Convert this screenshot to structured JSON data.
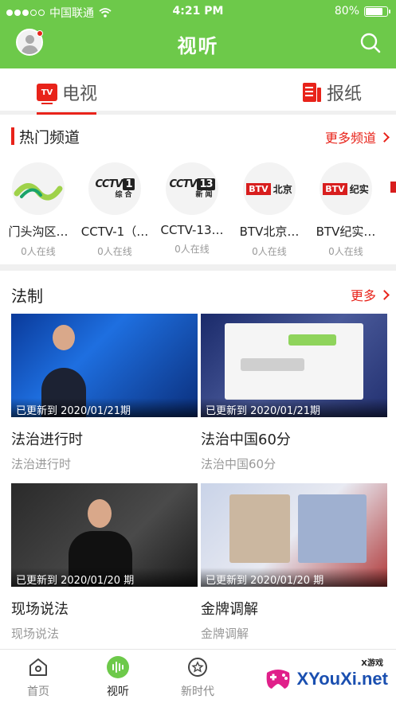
{
  "status_bar": {
    "carrier": "中国联通",
    "time": "4:21 PM",
    "battery": "80%",
    "battery_level": 0.8
  },
  "header": {
    "title": "视听"
  },
  "tabs": [
    {
      "label": "电视",
      "icon": "tv-icon",
      "icon_text": "TV",
      "active": true
    },
    {
      "label": "报纸",
      "icon": "newspaper-icon",
      "active": false
    }
  ],
  "hot_channels": {
    "title": "热门频道",
    "more": "更多频道",
    "items": [
      {
        "name": "门头沟区…",
        "online": "0人在线"
      },
      {
        "name": "CCTV-1（…",
        "online": "0人在线",
        "logo_text": "CCTV",
        "logo_num": "1",
        "logo_sub": "综合"
      },
      {
        "name": "CCTV-13…",
        "online": "0人在线",
        "logo_text": "CCTV",
        "logo_num": "13",
        "logo_sub": "新闻"
      },
      {
        "name": "BTV北京…",
        "online": "0人在线",
        "logo_text": "BTV",
        "logo_sub": "北京"
      },
      {
        "name": "BTV纪实…",
        "online": "0人在线",
        "logo_text": "BTV",
        "logo_sub": "纪实"
      }
    ]
  },
  "law_section": {
    "title": "法制",
    "more": "更多",
    "videos": [
      {
        "updated": "已更新到 2020/01/21期",
        "title": "法治进行时",
        "subtitle": "法治进行时"
      },
      {
        "updated": "已更新到 2020/01/21期",
        "title": "法治中国60分",
        "subtitle": "法治中国60分"
      },
      {
        "updated": "已更新到 2020/01/20 期",
        "title": "现场说法",
        "subtitle": "现场说法"
      },
      {
        "updated": "已更新到 2020/01/20 期",
        "title": "金牌调解",
        "subtitle": "金牌调解"
      }
    ]
  },
  "bottom_nav": [
    {
      "label": "首页",
      "icon": "home-icon"
    },
    {
      "label": "视听",
      "icon": "audio-wave-icon",
      "active": true
    },
    {
      "label": "新时代",
      "icon": "star-circle-icon"
    }
  ],
  "watermark": {
    "text": "XYouXi.net",
    "small": "X游戏"
  },
  "colors": {
    "brand_green": "#6dc94a",
    "accent_red": "#e8231a"
  }
}
